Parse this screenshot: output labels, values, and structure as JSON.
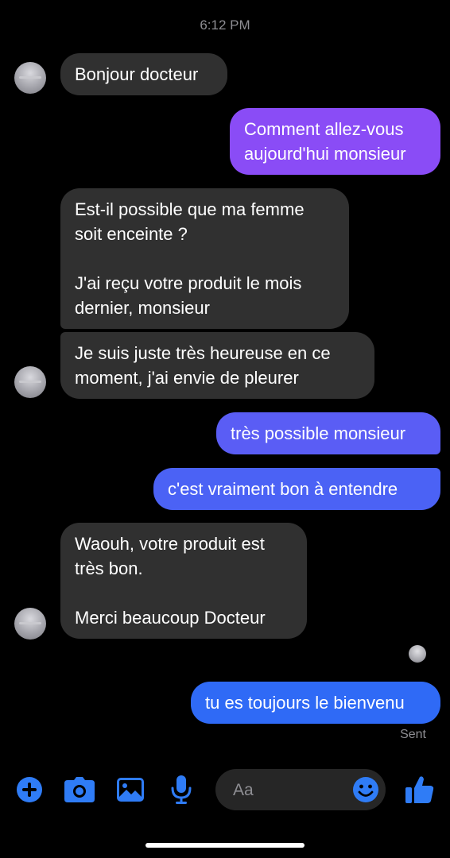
{
  "timestamp": "6:12 PM",
  "messages": [
    {
      "text": "Bonjour docteur"
    },
    {
      "text": "Comment allez-vous\naujourd'hui monsieur"
    },
    {
      "text": "Est-il possible que ma femme\nsoit enceinte ?\n\nJ'ai reçu votre produit le mois\ndernier, monsieur"
    },
    {
      "text": "Je suis juste très heureuse en ce\nmoment, j'ai envie de pleurer"
    },
    {
      "text": "très possible monsieur"
    },
    {
      "text": "c'est vraiment bon à entendre"
    },
    {
      "text": "Waouh, votre produit est\ntrès bon.\n\nMerci beaucoup Docteur"
    },
    {
      "text": "tu es toujours le bienvenu"
    }
  ],
  "status": "Sent",
  "composer": {
    "placeholder": "Aa"
  },
  "colors": {
    "incoming": "#303030",
    "outgoing_purple": "#8a4cf6",
    "outgoing_indigo": "#5a5df5",
    "outgoing_blue": "#2f6af6",
    "accent": "#2f7cf6"
  },
  "toolbar_icons": [
    "plus-icon",
    "camera-icon",
    "image-icon",
    "mic-icon",
    "emoji-icon",
    "thumbs-up-icon"
  ]
}
